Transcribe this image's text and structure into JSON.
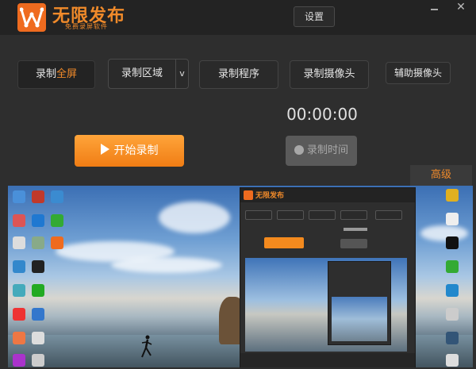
{
  "app": {
    "name": "无限发布",
    "slogan": "免费录屏软件",
    "settings_label": "设置",
    "minimize_icon": "minimize-icon",
    "close_icon": "close-icon",
    "close_glyph": "✕"
  },
  "modes": {
    "fullscreen_prefix": "录制",
    "fullscreen_highlight": "全屏",
    "region": "录制区域",
    "region_dropdown": "v",
    "program": "录制程序",
    "camera": "录制摄像头",
    "aux_camera": "辅助摄像头"
  },
  "timer": "00:00:00",
  "actions": {
    "start": "开始录制",
    "record_time": "录制时间"
  },
  "advanced_tab": "高级",
  "colors": {
    "accent": "#f08a2a",
    "start_button": "#f48a1e",
    "background": "#2e2e2e",
    "titlebar": "#232323"
  }
}
